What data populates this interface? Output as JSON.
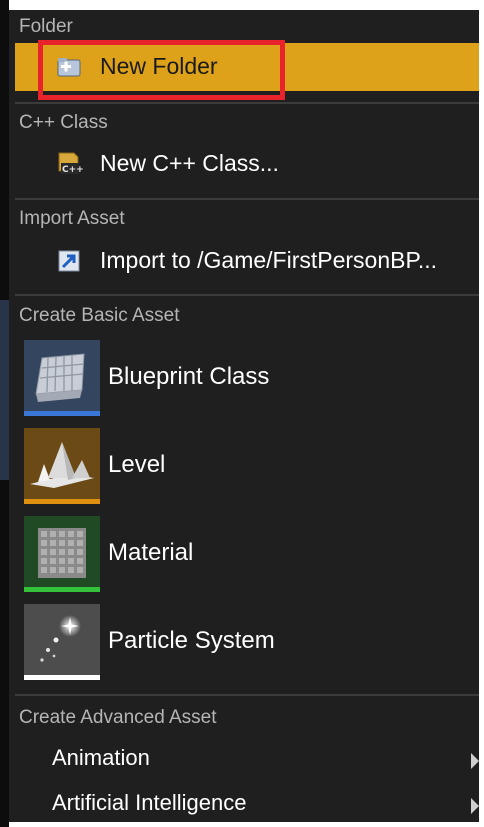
{
  "sections": {
    "folder": {
      "header": "Folder",
      "new_folder_label": "New Folder"
    },
    "cpp_class": {
      "header": "C++ Class",
      "new_cpp_class_label": "New C++ Class..."
    },
    "import_asset": {
      "header": "Import Asset",
      "import_label": "Import to /Game/FirstPersonBP..."
    },
    "basic_asset": {
      "header": "Create Basic Asset",
      "items": [
        {
          "label": "Blueprint Class",
          "icon": "blueprint-class-icon",
          "accent": "#3a77d6"
        },
        {
          "label": "Level",
          "icon": "level-icon",
          "accent": "#e0900e"
        },
        {
          "label": "Material",
          "icon": "material-icon",
          "accent": "#34c23a"
        },
        {
          "label": "Particle System",
          "icon": "particle-system-icon",
          "accent": "#ffffff"
        }
      ]
    },
    "advanced_asset": {
      "header": "Create Advanced Asset",
      "items": [
        {
          "label": "Animation"
        },
        {
          "label": "Artificial Intelligence"
        }
      ]
    }
  },
  "colors": {
    "menu_background": "#1f1f1f",
    "highlight": "#dea21a",
    "annotation_box": "#e8232b",
    "header_text": "#b5b5b5"
  }
}
